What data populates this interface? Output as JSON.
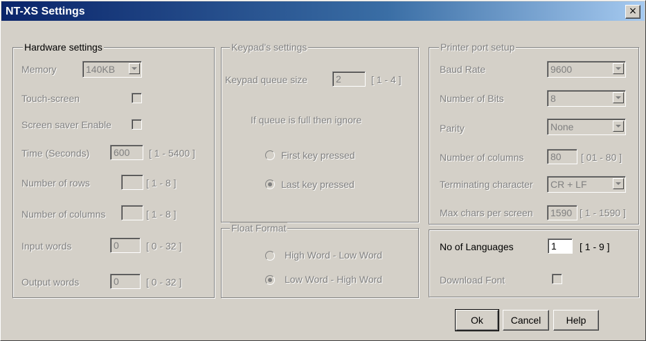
{
  "window": {
    "title": "NT-XS Settings",
    "close_symbol": "×"
  },
  "hardware": {
    "legend": "Hardware settings",
    "memory_label": "Memory",
    "memory_value": "140KB",
    "touchscreen_label": "Touch-screen",
    "screensaver_label": "Screen saver Enable",
    "time_label": "Time (Seconds)",
    "time_value": "600",
    "time_range": "[ 1 - 5400 ]",
    "rows_label": "Number of rows",
    "rows_value": "",
    "rows_range": "[ 1 - 8 ]",
    "columns_label": "Number of columns",
    "columns_value": "",
    "columns_range": "[ 1 - 8 ]",
    "input_label": "Input words",
    "input_value": "0",
    "input_range": "[ 0 - 32 ]",
    "output_label": "Output words",
    "output_value": "0",
    "output_range": "[ 0 - 32 ]"
  },
  "keypad": {
    "legend": "Keypad's settings",
    "queue_label": "Keypad queue size",
    "queue_value": "2",
    "queue_range": "[ 1 - 4 ]",
    "ignore_label": "If queue is full then ignore",
    "first_label": "First key pressed",
    "last_label": "Last key pressed"
  },
  "float": {
    "legend": "Float Format",
    "high_low_label": "High Word - Low Word",
    "low_high_label": "Low Word - High Word"
  },
  "printer": {
    "legend": "Printer port setup",
    "baud_label": "Baud Rate",
    "baud_value": "9600",
    "bits_label": "Number of Bits",
    "bits_value": "8",
    "parity_label": "Parity",
    "parity_value": "None",
    "columns_label": "Number of columns",
    "columns_value": "80",
    "columns_range": "[ 01 - 80 ]",
    "term_label": "Terminating character",
    "term_value": "CR + LF",
    "max_label": "Max chars per screen",
    "max_value": "1590",
    "max_range": "[ 1 - 1590 ]"
  },
  "languages": {
    "count_label": "No of Languages",
    "count_value": "1",
    "count_range": "[ 1 - 9 ]",
    "download_label": "Download Font"
  },
  "buttons": {
    "ok": "Ok",
    "cancel": "Cancel",
    "help": "Help"
  }
}
